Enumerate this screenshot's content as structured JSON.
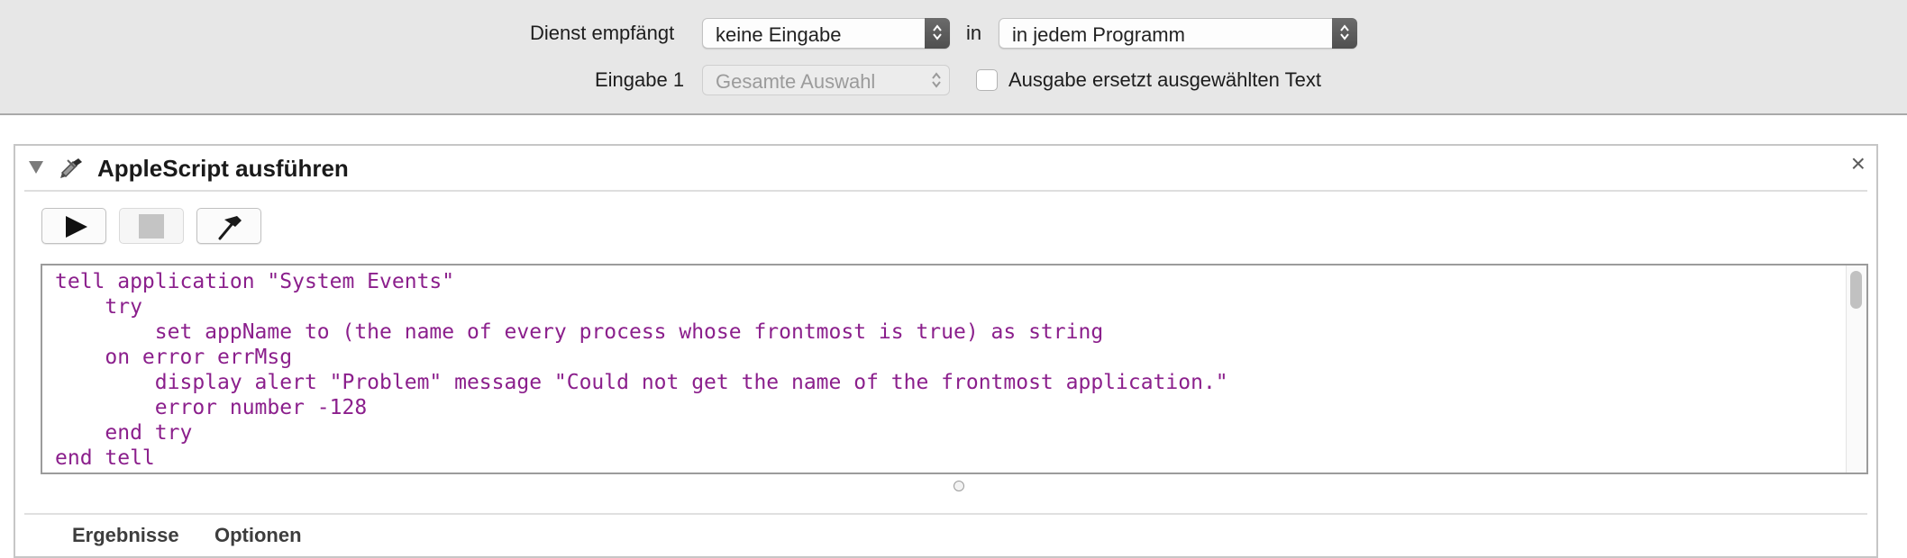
{
  "service_bar": {
    "receives_label": "Dienst empfängt",
    "receives_value": "keine Eingabe",
    "in_label": "in",
    "program_value": "in jedem Programm",
    "input_label": "Eingabe 1",
    "input_value": "Gesamte Auswahl",
    "replace_label": "Ausgabe ersetzt ausgewählten Text",
    "replace_checked": false
  },
  "action": {
    "title": "AppleScript ausführen",
    "close_symbol": "×",
    "toolbar": {
      "run_icon": "play-icon",
      "stop_icon": "stop-icon",
      "compile_icon": "hammer-icon"
    },
    "code_lines": [
      "tell application \"System Events\"",
      "    try",
      "        set appName to (the name of every process whose frontmost is true) as string",
      "    on error errMsg",
      "        display alert \"Problem\" message \"Could not get the name of the frontmost application.\"",
      "        error number -128",
      "    end try",
      "end tell"
    ],
    "tabs": [
      "Ergebnisse",
      "Optionen"
    ]
  },
  "colors": {
    "code_text": "#8b1f8c",
    "topbar_bg": "#e7e7e7"
  }
}
